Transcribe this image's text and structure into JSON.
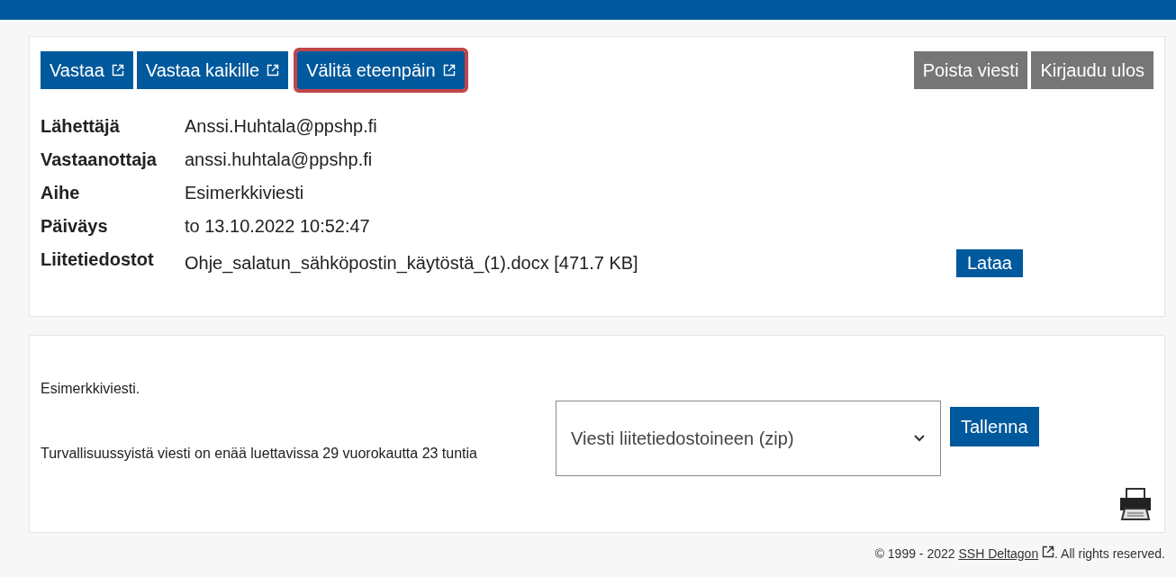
{
  "toolbar": {
    "left_buttons": [
      {
        "label": "Vastaa",
        "external": true,
        "highlighted": false
      },
      {
        "label": "Vastaa kaikille",
        "external": true,
        "highlighted": false
      },
      {
        "label": "Välitä eteenpäin",
        "external": true,
        "highlighted": true
      }
    ],
    "right_buttons": [
      {
        "label": "Poista viesti"
      },
      {
        "label": "Kirjaudu ulos"
      }
    ]
  },
  "headers": [
    {
      "label": "Lähettäjä",
      "value": "Anssi.Huhtala@ppshp.fi"
    },
    {
      "label": "Vastaanottaja",
      "value": "anssi.huhtala@ppshp.fi"
    },
    {
      "label": "Aihe",
      "value": "Esimerkkiviesti"
    },
    {
      "label": "Päiväys",
      "value": "to 13.10.2022 10:52:47"
    }
  ],
  "attachments": {
    "label": "Liitetiedostot",
    "file": "Ohje_salatun_sähköpostin_käytöstä_(1).docx [471.7 KB]",
    "button": "Lataa"
  },
  "body": {
    "text": "Esimerkkiviesti.",
    "expiry": "Turvallisuussyistä viesti on enää luettavissa 29 vuorokautta 23 tuntia",
    "save_select": {
      "value": "Viesti liitetiedostoineen (zip)"
    },
    "save_button": "Tallenna"
  },
  "footer": {
    "before": "© 1999 - 2022",
    "link": "SSH Deltagon",
    "after": ". All rights reserved."
  }
}
